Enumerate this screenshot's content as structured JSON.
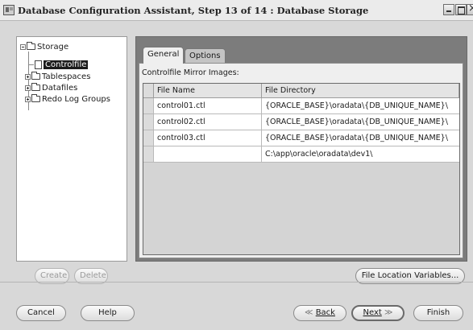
{
  "window": {
    "title": "Database Configuration Assistant, Step 13 of 14 : Database Storage"
  },
  "tree": {
    "root": "Storage",
    "items": [
      {
        "label": "Controlfile",
        "selected": true
      },
      {
        "label": "Tablespaces",
        "expandable": true
      },
      {
        "label": "Datafiles",
        "expandable": true
      },
      {
        "label": "Redo Log Groups",
        "expandable": true
      }
    ]
  },
  "tabs": [
    {
      "label": "General",
      "active": true
    },
    {
      "label": "Options",
      "active": false
    }
  ],
  "general": {
    "section_label": "Controlfile Mirror Images:",
    "columns": [
      "File Name",
      "File Directory"
    ],
    "rows": [
      {
        "name": "control01.ctl",
        "directory": "{ORACLE_BASE}\\oradata\\{DB_UNIQUE_NAME}\\"
      },
      {
        "name": "control02.ctl",
        "directory": "{ORACLE_BASE}\\oradata\\{DB_UNIQUE_NAME}\\"
      },
      {
        "name": "control03.ctl",
        "directory": "{ORACLE_BASE}\\oradata\\{DB_UNIQUE_NAME}\\"
      },
      {
        "name": "",
        "directory": "C:\\app\\oracle\\oradata\\dev1\\"
      }
    ]
  },
  "buttons": {
    "create": "Create",
    "delete": "Delete",
    "file_location_variables": "File Location Variables...",
    "cancel": "Cancel",
    "help": "Help",
    "back": "Back",
    "next": "Next",
    "finish": "Finish"
  }
}
